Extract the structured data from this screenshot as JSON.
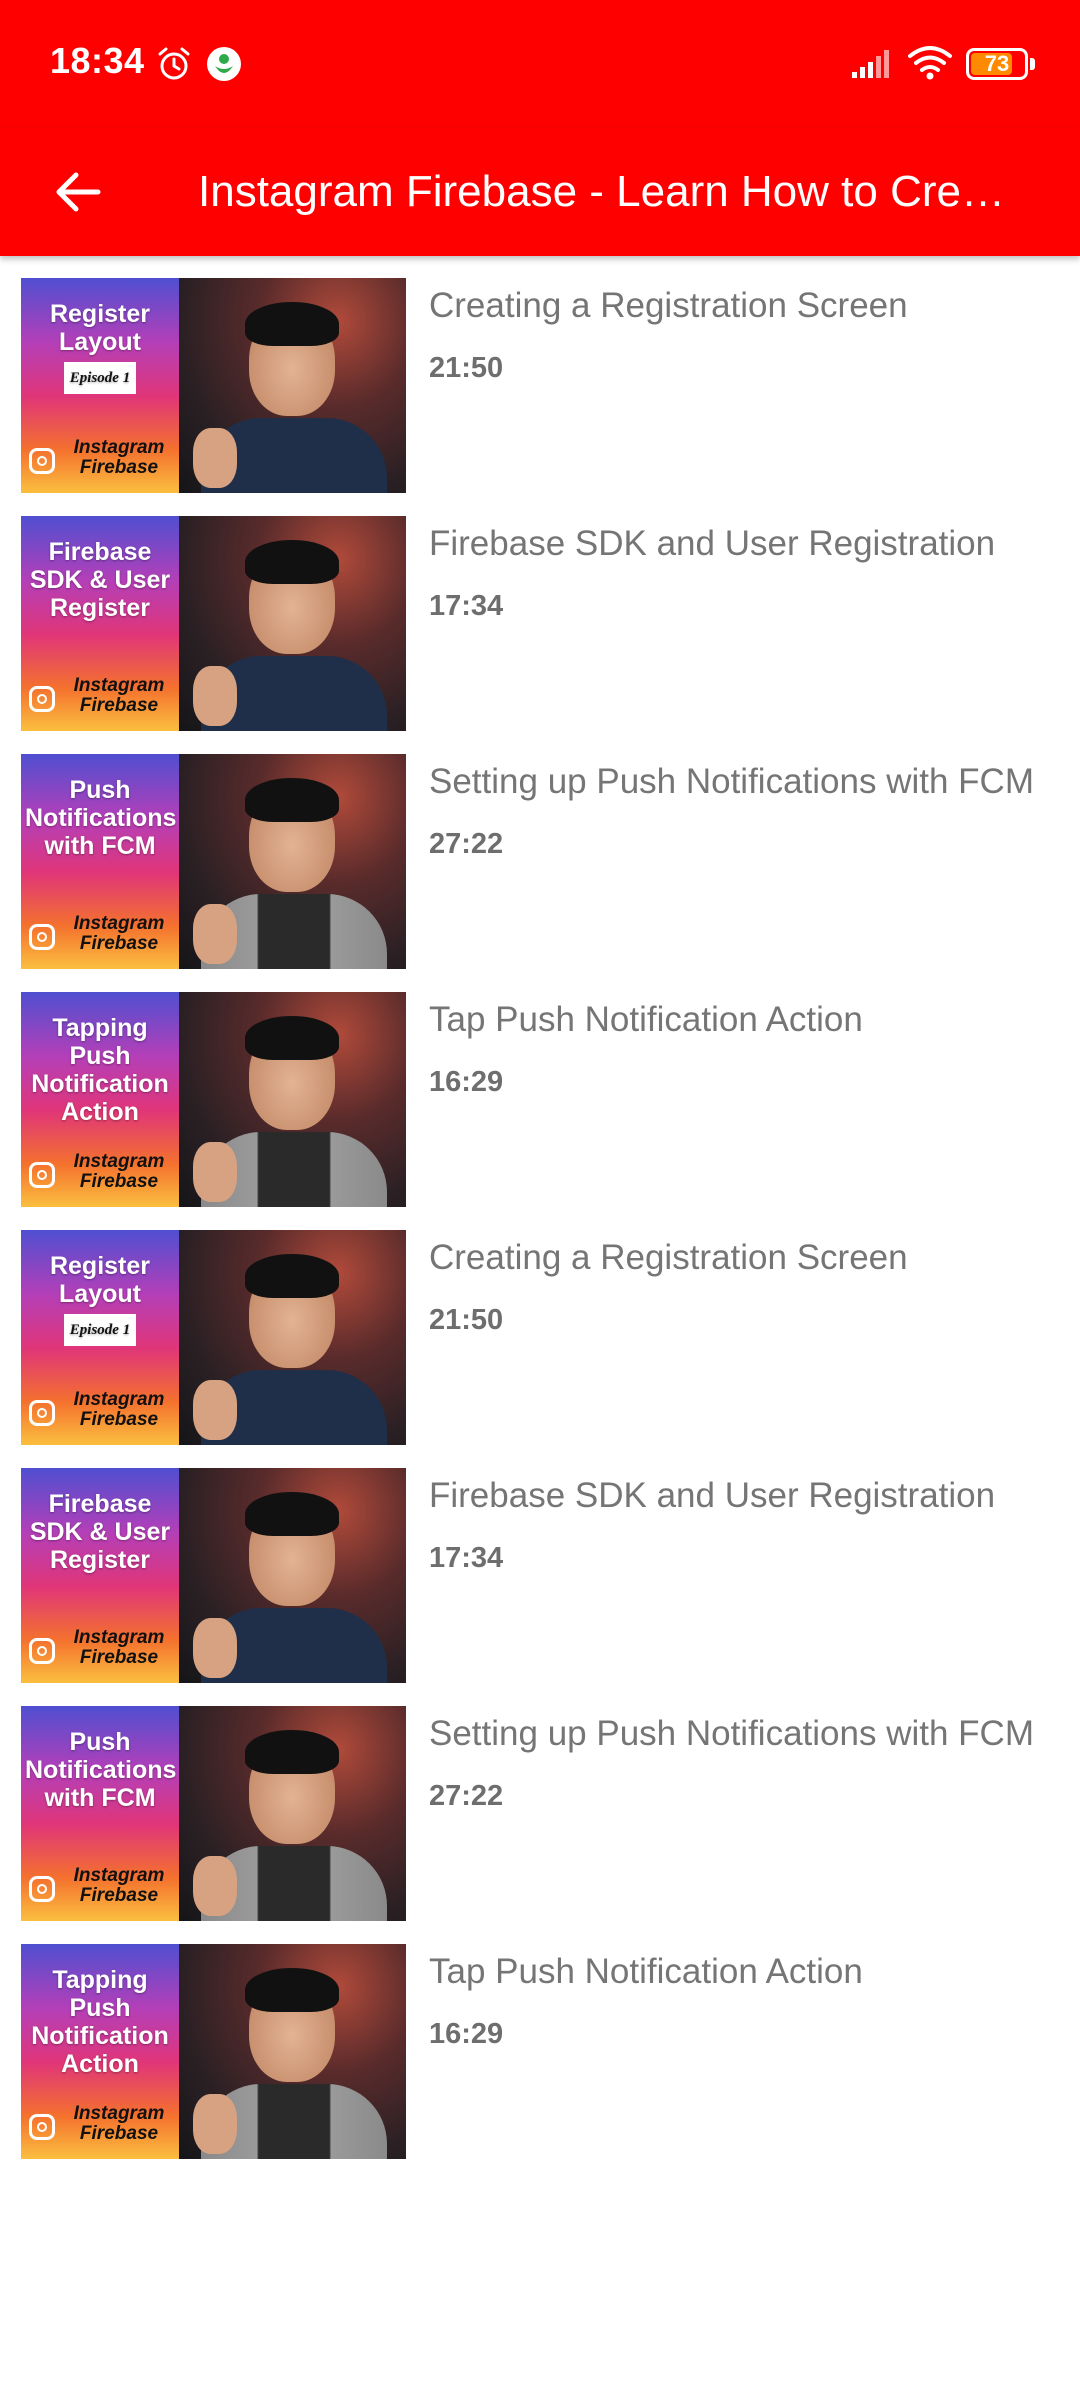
{
  "status_bar": {
    "time": "18:34",
    "battery_level": "73",
    "icons": [
      "alarm-icon",
      "app-badge-icon",
      "signal-icon",
      "wifi-icon",
      "battery-icon"
    ]
  },
  "app_bar": {
    "title": "Instagram Firebase - Learn How to Create Instagram",
    "back_icon": "arrow-left-icon",
    "background": "#ff0000"
  },
  "videos": [
    {
      "title": "Creating a Registration Screen",
      "duration": "21:50",
      "thumb_caption": "Register Layout",
      "thumb_tag": "Episode 1",
      "thumb_brand": "Instagram Firebase"
    },
    {
      "title": "Firebase SDK and User Registration",
      "duration": "17:34",
      "thumb_caption": "Firebase SDK & User Register",
      "thumb_tag": "",
      "thumb_brand": "Instagram Firebase"
    },
    {
      "title": "Setting up Push Notifications with FCM",
      "duration": "27:22",
      "thumb_caption": "Push Notifications with FCM",
      "thumb_tag": "",
      "thumb_brand": "Instagram Firebase"
    },
    {
      "title": "Tap Push Notification Action",
      "duration": "16:29",
      "thumb_caption": "Tapping Push Notification Action",
      "thumb_tag": "",
      "thumb_brand": "Instagram Firebase"
    },
    {
      "title": "Creating a Registration Screen",
      "duration": "21:50",
      "thumb_caption": "Register Layout",
      "thumb_tag": "Episode 1",
      "thumb_brand": "Instagram Firebase"
    },
    {
      "title": "Firebase SDK and User Registration",
      "duration": "17:34",
      "thumb_caption": "Firebase SDK & User Register",
      "thumb_tag": "",
      "thumb_brand": "Instagram Firebase"
    },
    {
      "title": "Setting up Push Notifications with FCM",
      "duration": "27:22",
      "thumb_caption": "Push Notifications with FCM",
      "thumb_tag": "",
      "thumb_brand": "Instagram Firebase"
    },
    {
      "title": "Tap Push Notification Action",
      "duration": "16:29",
      "thumb_caption": "Tapping Push Notification Action",
      "thumb_tag": "",
      "thumb_brand": "Instagram Firebase"
    }
  ]
}
